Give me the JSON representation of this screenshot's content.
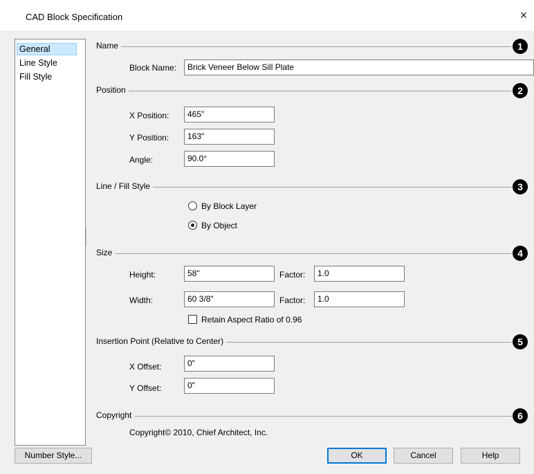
{
  "window": {
    "title": "CAD Block Specification",
    "close_glyph": "×"
  },
  "sidebar": {
    "items": [
      {
        "label": "General",
        "selected": true
      },
      {
        "label": "Line Style",
        "selected": false
      },
      {
        "label": "Fill Style",
        "selected": false
      }
    ]
  },
  "sections": {
    "name": {
      "title": "Name",
      "badge": "1",
      "block_name_label": "Block Name:",
      "block_name_value": "Brick Veneer Below Sill Plate"
    },
    "position": {
      "title": "Position",
      "badge": "2",
      "x_label": "X Position:",
      "x_value": "465\"",
      "y_label": "Y Position:",
      "y_value": "163\"",
      "angle_label": "Angle:",
      "angle_value": "90.0°"
    },
    "line_fill": {
      "title": "Line / Fill Style",
      "badge": "3",
      "option_block_layer": "By Block Layer",
      "option_object": "By Object",
      "selected": "By Object"
    },
    "size": {
      "title": "Size",
      "badge": "4",
      "height_label": "Height:",
      "height_value": "58\"",
      "width_label": "Width:",
      "width_value": "60 3/8\"",
      "factor_label": "Factor:",
      "height_factor": "1.0",
      "width_factor": "1.0",
      "retain_label": "Retain Aspect Ratio of 0.96",
      "retain_checked": false
    },
    "insertion": {
      "title": "Insertion Point (Relative to Center)",
      "badge": "5",
      "x_offset_label": "X Offset:",
      "x_offset_value": "0\"",
      "y_offset_label": "Y Offset:",
      "y_offset_value": "0\""
    },
    "copyright": {
      "title": "Copyright",
      "badge": "6",
      "text": "Copyright© 2010, Chief Architect, Inc."
    }
  },
  "buttons": {
    "number_style": "Number Style...",
    "ok": "OK",
    "cancel": "Cancel",
    "help": "Help"
  }
}
